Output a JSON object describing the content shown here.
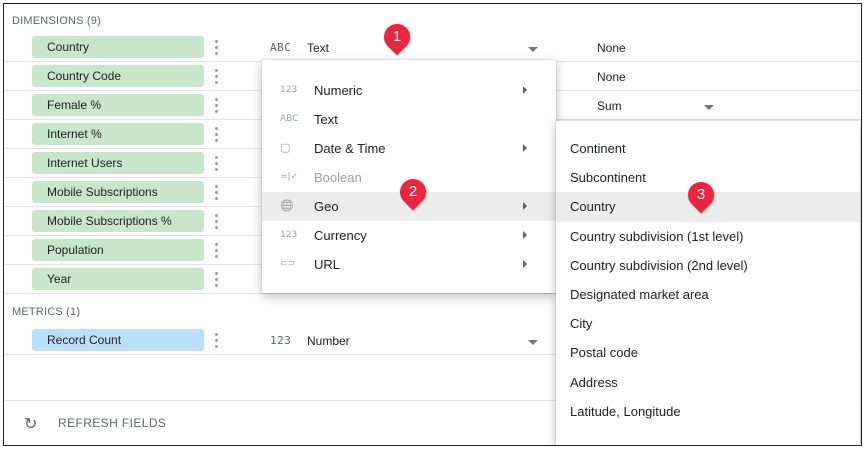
{
  "dimensions": {
    "header": "DIMENSIONS (9)",
    "fields": [
      {
        "name": "Country",
        "type_icon": "ABC",
        "type": "Text",
        "aggregation": "None"
      },
      {
        "name": "Country Code",
        "aggregation": "None"
      },
      {
        "name": "Female %",
        "aggregation": "Sum"
      },
      {
        "name": "Internet %"
      },
      {
        "name": "Internet Users"
      },
      {
        "name": "Mobile Subscriptions"
      },
      {
        "name": "Mobile Subscriptions %"
      },
      {
        "name": "Population"
      },
      {
        "name": "Year"
      }
    ]
  },
  "metrics": {
    "header": "METRICS (1)",
    "fields": [
      {
        "name": "Record Count",
        "type_icon": "123",
        "type": "Number"
      }
    ]
  },
  "type_menu": {
    "items": [
      {
        "icon": "123",
        "label": "Numeric",
        "submenu": true
      },
      {
        "icon": "ABC",
        "label": "Text",
        "submenu": false
      },
      {
        "icon": "▢",
        "label": "Date & Time",
        "submenu": true
      },
      {
        "icon": "=|✓",
        "label": "Boolean",
        "submenu": false,
        "disabled": true
      },
      {
        "icon": "🌐",
        "label": "Geo",
        "submenu": true,
        "highlighted": true
      },
      {
        "icon": "123",
        "label": "Currency",
        "submenu": true
      },
      {
        "icon": "⊂⊃",
        "label": "URL",
        "submenu": true
      }
    ]
  },
  "geo_menu": {
    "items": [
      {
        "label": "Continent"
      },
      {
        "label": "Subcontinent"
      },
      {
        "label": "Country",
        "highlighted": true
      },
      {
        "label": "Country subdivision (1st level)"
      },
      {
        "label": "Country subdivision (2nd level)"
      },
      {
        "label": "Designated market area"
      },
      {
        "label": "City"
      },
      {
        "label": "Postal code"
      },
      {
        "label": "Address"
      },
      {
        "label": "Latitude, Longitude"
      }
    ]
  },
  "callouts": [
    "1",
    "2",
    "3"
  ],
  "footer": {
    "refresh_label": "REFRESH FIELDS",
    "refresh_icon": "refresh-icon"
  },
  "colors": {
    "dimension_chip": "#c8e6c9",
    "metric_chip": "#bbdefb",
    "callout": "#e8263f",
    "highlight": "#ececec"
  }
}
